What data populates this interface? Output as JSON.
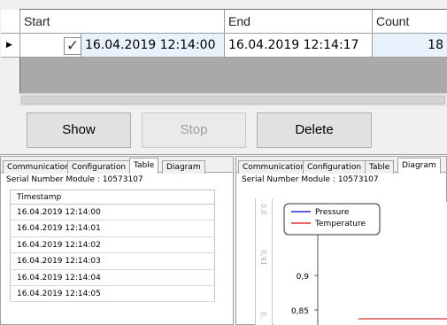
{
  "grid": {
    "columns": [
      "Start",
      "End",
      "Count"
    ],
    "row": {
      "checked_mark": "✓",
      "start": "16.04.2019 12:14:00",
      "end": "16.04.2019 12:14:17",
      "count": "18"
    }
  },
  "buttons": {
    "show": "Show",
    "stop": "Stop",
    "delete": "Delete"
  },
  "tabs": [
    "Communication",
    "Configuration",
    "Table",
    "Diagram"
  ],
  "left_pane": {
    "serial": "Serial Number Module : 10573107",
    "table_header": "Timestamp",
    "rows": [
      "16.04.2019 12:14:00",
      "16.04.2019 12:14:01",
      "16.04.2019 12:14:02",
      "16.04.2019 12:14:03",
      "16.04.2019 12:14:04",
      "16.04.2019 12:14:05"
    ]
  },
  "right_pane": {
    "serial": "Serial Number Module : 10573107",
    "axis_strip_labels": [
      "0,0",
      "0,91",
      "0,"
    ]
  },
  "chart_data": {
    "type": "line",
    "series": [
      {
        "name": "Pressure",
        "color": "#2a2adf",
        "values": []
      },
      {
        "name": "Temperature",
        "color": "#e03030",
        "values": [
          0.83,
          0.83
        ]
      }
    ],
    "y_ticks": [
      "0,9",
      "0,85"
    ],
    "legend": "top-left",
    "colors": {
      "pressure": "#2a2adf",
      "temperature": "#e03030"
    }
  }
}
